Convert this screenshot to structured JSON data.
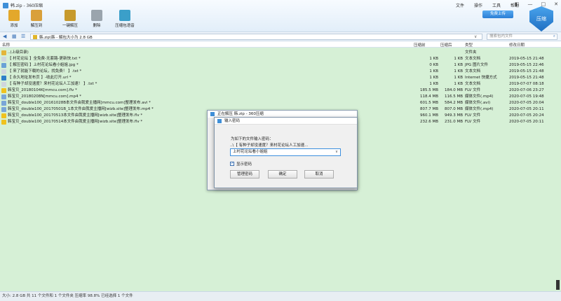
{
  "app": {
    "title": "韩.zip - 360压缩"
  },
  "menu": [
    "文件",
    "操作",
    "工具",
    "帮助"
  ],
  "toolbar": [
    {
      "label": "添加",
      "icon": "add-icon",
      "color": "#e3a82b"
    },
    {
      "label": "解压到",
      "icon": "extract-to-icon",
      "color": "#d9a03a"
    },
    {
      "label": "一键解压",
      "icon": "one-click-extract-icon",
      "color": "#c79a2c"
    },
    {
      "label": "删除",
      "icon": "delete-icon",
      "color": "#9aa4ad"
    },
    {
      "label": "压缩包语音",
      "icon": "archive-voice-icon",
      "color": "#3b9fc9"
    }
  ],
  "login_label": "免费上传",
  "brand_label": "压缩",
  "address": {
    "path": "韩.zip\\韩 - 解包大小为 2.8 GB",
    "search_placeholder": "搜索包内文件"
  },
  "columns": {
    "name": "名称",
    "size": "压缩前",
    "csize": "压缩后",
    "type": "类型",
    "date": "修改日期"
  },
  "files": [
    {
      "name": "..(上级目录)",
      "size": "",
      "csize": "",
      "type": "文件夹",
      "date": "",
      "icon": "folder-icon",
      "color": "#e3b53a"
    },
    {
      "name": "【 村花论坛 】全免费-无套路-更新快.txt *",
      "size": "1 KB",
      "csize": "1 KB",
      "type": "文本文档",
      "date": "2019-05-15 21:48",
      "icon": "text-file-icon",
      "color": "#cfd6dd"
    },
    {
      "name": "【 解压密码 】上村花论坛看小姐姐.jpg *",
      "size": "0 KB",
      "csize": "1 KB",
      "type": "JPG 图片文件",
      "date": "2019-05-15 22:46",
      "icon": "image-file-icon",
      "color": "#6aa2d6"
    },
    {
      "name": "【 来了就能下载的论坛，找免费！ 】.txt *",
      "size": "1 KB",
      "csize": "1 KB",
      "type": "文本文档",
      "date": "2019-05-15 21:48",
      "icon": "text-file-icon",
      "color": "#cfd6dd"
    },
    {
      "name": "【 永久地址发布页 】-收此打开.url *",
      "size": "1 KB",
      "csize": "1 KB",
      "type": "Internet 快捷方式",
      "date": "2019-05-15 21:48",
      "icon": "globe-icon",
      "color": "#2e7fc9"
    },
    {
      "name": "【 有种子却没速度？来村花论坛人工加速！ 】.txt *",
      "size": "1 KB",
      "csize": "1 KB",
      "type": "文本文档",
      "date": "2019-07-07 08:18",
      "icon": "text-file-icon",
      "color": "#cfd6dd"
    },
    {
      "name": "韩宝贝_20180104K[mmcu.com].flv *",
      "size": "185.5 MB",
      "csize": "184.0 MB",
      "type": "FLV 文件",
      "date": "2020-07-06 23:27",
      "icon": "video-file-icon",
      "color": "#f0c21e"
    },
    {
      "name": "韩宝贝_20180208N[mmcu.com].mp4 *",
      "size": "118.4 MB",
      "csize": "116.5 MB",
      "type": "媒体文件(.mp4)",
      "date": "2020-07-05 19:48",
      "icon": "media-file-icon",
      "color": "#7aa6d8"
    },
    {
      "name": "韩宝贝_double100_20161028B本文件由我爱主播网[mmcu.com]整理发布.avi *",
      "size": "601.5 MB",
      "csize": "584.2 MB",
      "type": "媒体文件(.avi)",
      "date": "2020-07-05 20:04",
      "icon": "media-file-icon",
      "color": "#7aa6d8"
    },
    {
      "name": "韩宝贝_double100_20170501B_1本文件由我爱主播网[wizb.site]整理发布.mp4 *",
      "size": "807.7 MB",
      "csize": "807.0 MB",
      "type": "媒体文件(.mp4)",
      "date": "2020-07-05 20:11",
      "icon": "media-file-icon",
      "color": "#7aa6d8"
    },
    {
      "name": "韩宝贝_double100_20170513本文件由我爱主播网[wizb.site]整理发布.flv *",
      "size": "960.1 MB",
      "csize": "949.3 MB",
      "type": "FLV 文件",
      "date": "2020-07-05 20:24",
      "icon": "video-file-icon",
      "color": "#f0c21e"
    },
    {
      "name": "韩宝贝_double100_20170514本文件由我爱主播网[wizb.site]整理发布.flv *",
      "size": "232.6 MB",
      "csize": "231.0 MB",
      "type": "FLV 文件",
      "date": "2020-07-05 20:11",
      "icon": "video-file-icon",
      "color": "#f0c21e"
    }
  ],
  "status": "大小: 2.8 GB 共 11 个文件和 1 个文件夹 压缩率 98.8% 已经选择 1 个文件",
  "extract_dialog": {
    "title": "正在解压 韩.zip - 360压缩"
  },
  "password_dialog": {
    "title": "输入密码",
    "prompt": "为如下的文件输入密码：",
    "file": "..\\【 有种子却没速度？来村花论坛人工加速...",
    "value": "上村花论坛看小姐姐",
    "show_password_label": "显示密码",
    "show_password_checked": "✓",
    "manage_label": "管理密码",
    "ok_label": "确定",
    "cancel_label": "取消"
  }
}
